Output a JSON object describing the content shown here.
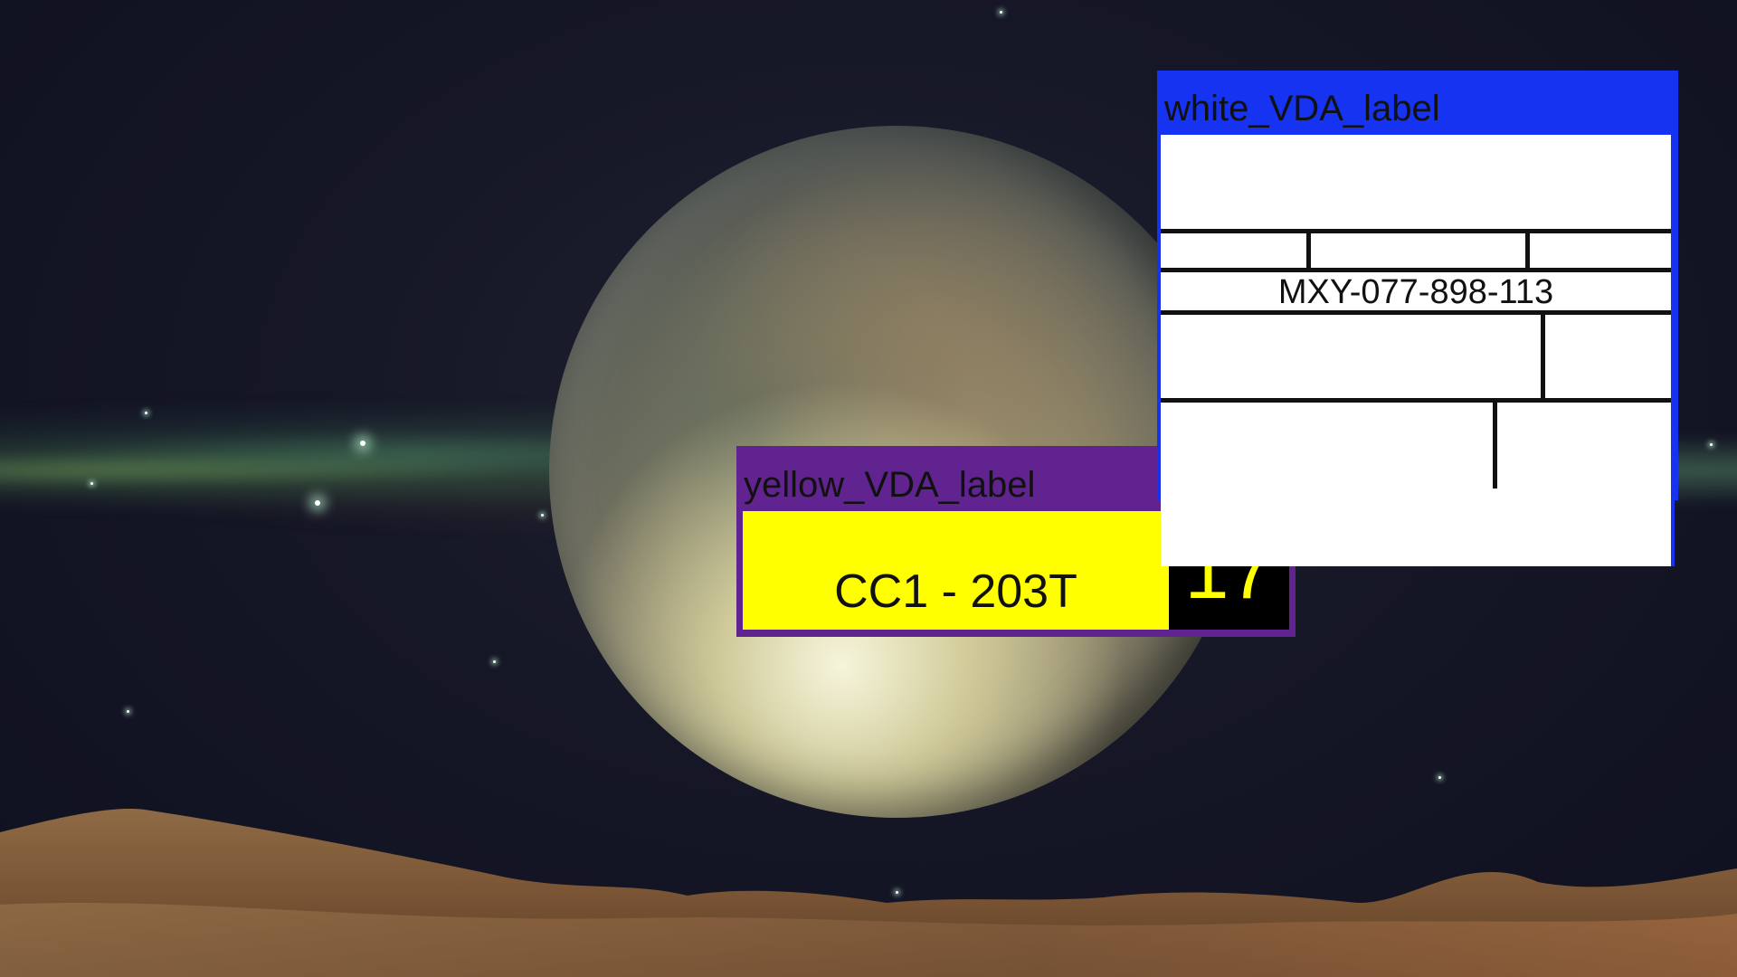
{
  "yellow_label": {
    "title": "yellow_VDA_label",
    "code": "CC1 - 203T",
    "number": "17",
    "titlebar_color": "#612390",
    "body_color": "#ffff00",
    "number_color": "#ffff00"
  },
  "white_label": {
    "title": "white_VDA_label",
    "serial": "MXY-077-898-113",
    "titlebar_color": "#1533f0",
    "body_color": "#ffffff"
  }
}
